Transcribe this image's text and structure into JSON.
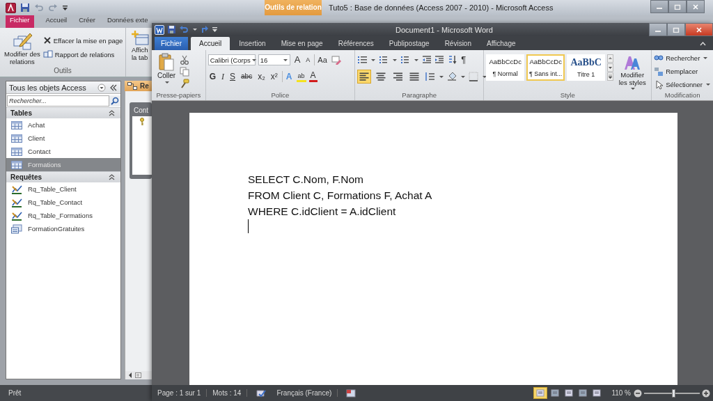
{
  "access": {
    "context_tab": "Outils de relation",
    "title": "Tuto5 : Base de données (Access 2007 - 2010) - Microsoft Access",
    "tabs": [
      {
        "label": "Fichier",
        "kind": "file"
      },
      {
        "label": "Accueil",
        "kind": "tab"
      },
      {
        "label": "Créer",
        "kind": "tab"
      },
      {
        "label": "Données exte",
        "kind": "tab"
      }
    ],
    "ribbon": {
      "group_label": "Outils",
      "large_button": [
        "Modifier des",
        "relations"
      ],
      "small_buttons": [
        {
          "label": "Effacer la mise en page",
          "kind": "clear"
        },
        {
          "label": "Rapport de relations",
          "kind": "report"
        }
      ],
      "cut_button": [
        "Affich",
        "la tab"
      ]
    },
    "nav": {
      "title": "Tous les objets Access",
      "search_placeholder": "Rechercher...",
      "groups": [
        {
          "label": "Tables",
          "items": [
            {
              "label": "Achat",
              "kind": "table",
              "selected": false
            },
            {
              "label": "Client",
              "kind": "table",
              "selected": false
            },
            {
              "label": "Contact",
              "kind": "table",
              "selected": false
            },
            {
              "label": "Formations",
              "kind": "table",
              "selected": true
            }
          ]
        },
        {
          "label": "Requêtes",
          "items": [
            {
              "label": "Rq_Table_Client",
              "kind": "query",
              "selected": false
            },
            {
              "label": "Rq_Table_Contact",
              "kind": "query",
              "selected": false
            },
            {
              "label": "Rq_Table_Formations",
              "kind": "query",
              "selected": false
            },
            {
              "label": "FormationGratuites",
              "kind": "form",
              "selected": false
            }
          ]
        }
      ]
    },
    "document_tab": "Re",
    "relation_table": "Cont",
    "status": "Prêt"
  },
  "word": {
    "title": "Document1 - Microsoft Word",
    "tabs": [
      {
        "label": "Fichier",
        "kind": "file",
        "selected": false
      },
      {
        "label": "Accueil",
        "kind": "tab",
        "selected": true
      },
      {
        "label": "Insertion",
        "kind": "tab",
        "selected": false
      },
      {
        "label": "Mise en page",
        "kind": "tab",
        "selected": false
      },
      {
        "label": "Références",
        "kind": "tab",
        "selected": false
      },
      {
        "label": "Publipostage",
        "kind": "tab",
        "selected": false
      },
      {
        "label": "Révision",
        "kind": "tab",
        "selected": false
      },
      {
        "label": "Affichage",
        "kind": "tab",
        "selected": false
      }
    ],
    "clipboard": {
      "paste": "Coller",
      "label": "Presse-papiers"
    },
    "font": {
      "name": "Calibri (Corps",
      "size": "16",
      "label": "Police",
      "row1": [
        {
          "text": "A",
          "kind": "grow"
        },
        {
          "text": "A",
          "kind": "shrink"
        },
        {
          "text": "Aa",
          "kind": "case"
        }
      ],
      "row2": [
        {
          "text": "G",
          "kind": "bold"
        },
        {
          "text": "I",
          "kind": "italic"
        },
        {
          "text": "S",
          "kind": "underline"
        },
        {
          "text": "abc",
          "kind": "strike"
        },
        {
          "text": "x₂",
          "kind": "sub"
        },
        {
          "text": "x²",
          "kind": "sup"
        },
        {
          "text": "A",
          "kind": "effects"
        },
        {
          "text": "ab",
          "kind": "highlight"
        },
        {
          "text": "A",
          "kind": "color"
        }
      ]
    },
    "paragraph": {
      "label": "Paragraphe",
      "pilcrow": "¶",
      "align": [
        {
          "kind": "left",
          "selected": true
        },
        {
          "kind": "center",
          "selected": false
        },
        {
          "kind": "right",
          "selected": false
        },
        {
          "kind": "justify",
          "selected": false
        }
      ]
    },
    "styles": {
      "label": "Style",
      "change": "Modifier les styles",
      "items": [
        {
          "preview": "AaBbCcDc",
          "name": "¶ Normal",
          "kind": "body",
          "selected": false
        },
        {
          "preview": "AaBbCcDc",
          "name": "¶ Sans int...",
          "kind": "body",
          "selected": true
        },
        {
          "preview": "AaBbC",
          "name": "Titre 1",
          "kind": "heading",
          "selected": false
        }
      ]
    },
    "editing": {
      "label": "Modification",
      "items": [
        {
          "label": "Rechercher",
          "kind": "find"
        },
        {
          "label": "Remplacer",
          "kind": "replace"
        },
        {
          "label": "Sélectionner",
          "kind": "select"
        }
      ]
    },
    "document": {
      "lines": [
        "SELECT C.Nom, F.Nom",
        "FROM Client C, Formations F, Achat A",
        "WHERE C.idClient = A.idClient"
      ],
      "cursor": true
    },
    "status": {
      "page": "Page : 1 sur 1",
      "words": "Mots : 14",
      "language": "Français (France)",
      "zoom": "110 %",
      "zoom_level": {
        "level": 0.52
      },
      "views": [
        {
          "selected": true
        },
        {
          "selected": false
        },
        {
          "selected": false
        },
        {
          "selected": false
        },
        {
          "selected": false
        }
      ]
    }
  }
}
